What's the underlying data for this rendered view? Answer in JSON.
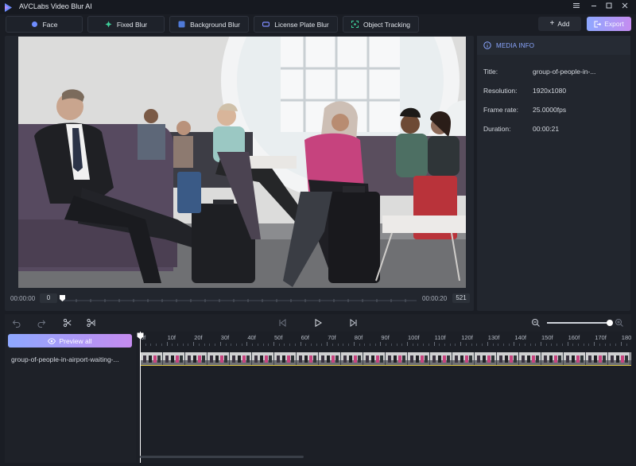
{
  "window": {
    "title": "AVCLabs Video Blur AI",
    "controls": [
      "menu-icon",
      "minimize-icon",
      "maximize-icon",
      "close-icon"
    ]
  },
  "toolbar": {
    "tools": [
      {
        "label": "Face",
        "icon": "face-icon"
      },
      {
        "label": "Fixed Blur",
        "icon": "fixed-blur-icon"
      },
      {
        "label": "Background Blur",
        "icon": "background-blur-icon"
      },
      {
        "label": "License Plate Blur",
        "icon": "license-plate-icon"
      },
      {
        "label": "Object Tracking",
        "icon": "object-tracking-icon"
      }
    ],
    "add_label": "Add",
    "export_label": "Export"
  },
  "preview": {
    "time_start": "00:00:00",
    "current_frame": "0",
    "time_end": "00:00:20",
    "total_frames": "521"
  },
  "media_info": {
    "header": "MEDIA INFO",
    "rows": [
      {
        "label": "Title:",
        "value": "group-of-people-in-..."
      },
      {
        "label": "Resolution:",
        "value": "1920x1080"
      },
      {
        "label": "Frame rate:",
        "value": "25.0000fps"
      },
      {
        "label": "Duration:",
        "value": "00:00:21"
      }
    ]
  },
  "timeline": {
    "preview_all_label": "Preview all",
    "clip_name": "group-of-people-in-airport-waiting-...",
    "ruler": [
      "0f",
      "10f",
      "20f",
      "30f",
      "40f",
      "50f",
      "60f",
      "70f",
      "80f",
      "90f",
      "100f",
      "110f",
      "120f",
      "130f",
      "140f",
      "150f",
      "160f",
      "170f",
      "180f"
    ],
    "zoom_level": 1.0
  },
  "colors": {
    "accent_start": "#8ea8ff",
    "accent_end": "#c58cf0",
    "info_header": "#8aa6ff",
    "clip_line": "#e2c94a"
  }
}
